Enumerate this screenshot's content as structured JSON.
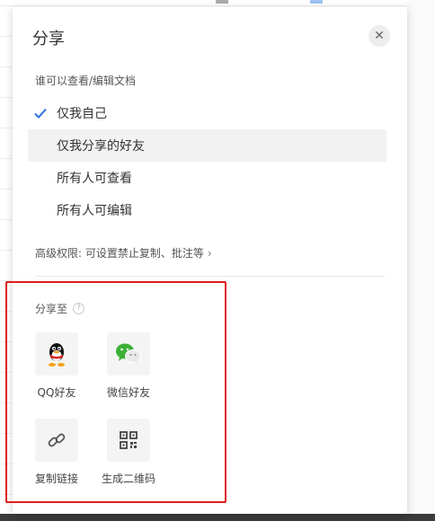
{
  "dialog": {
    "title": "分享",
    "close_icon": "close-icon",
    "permission_label": "谁可以查看/编辑文档",
    "options": [
      {
        "label": "仅我自己",
        "selected": true
      },
      {
        "label": "仅我分享的好友",
        "selected": false
      },
      {
        "label": "所有人可查看",
        "selected": false
      },
      {
        "label": "所有人可编辑",
        "selected": false
      }
    ],
    "advanced_label": "高级权限: 可设置禁止复制、批注等",
    "share_to_label": "分享至",
    "share_targets": [
      {
        "label": "QQ好友",
        "icon": "qq-icon"
      },
      {
        "label": "微信好友",
        "icon": "wechat-icon"
      },
      {
        "label": "复制链接",
        "icon": "link-icon"
      },
      {
        "label": "生成二维码",
        "icon": "qrcode-icon"
      }
    ]
  },
  "colors": {
    "accent": "#2f6fe0",
    "highlight_box": "#e11d1d",
    "hover_row": "#f2f2f2",
    "tile_bg": "#f4f4f4",
    "wechat": "#3cb035"
  }
}
